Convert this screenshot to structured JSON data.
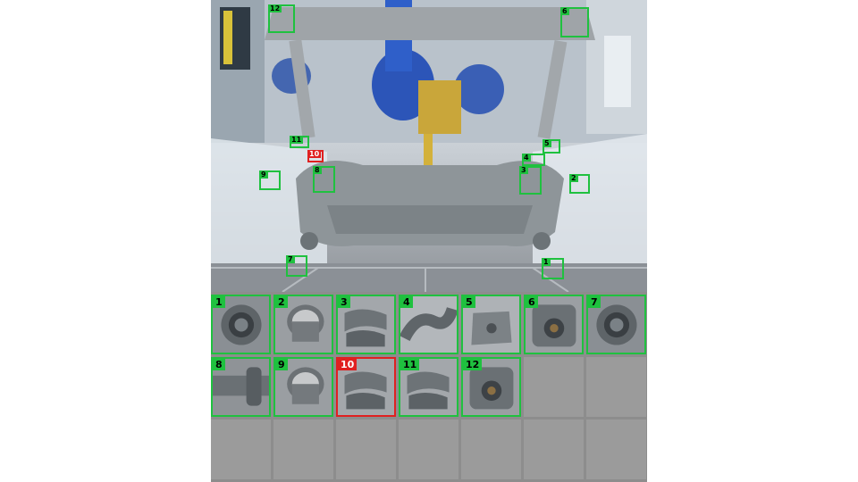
{
  "camera_view": {
    "detections": [
      {
        "label": "12",
        "status": "pass"
      },
      {
        "label": "6",
        "status": "pass"
      },
      {
        "label": "11",
        "status": "pass"
      },
      {
        "label": "5",
        "status": "pass"
      },
      {
        "label": "10",
        "status": "fail"
      },
      {
        "label": "4",
        "status": "pass"
      },
      {
        "label": "9",
        "status": "pass"
      },
      {
        "label": "8",
        "status": "pass"
      },
      {
        "label": "3",
        "status": "pass"
      },
      {
        "label": "2",
        "status": "pass"
      },
      {
        "label": "7",
        "status": "pass"
      },
      {
        "label": "1",
        "status": "pass"
      }
    ]
  },
  "thumbnails": [
    {
      "label": "1",
      "status": "pass",
      "icon": "round-bushing-icon"
    },
    {
      "label": "2",
      "status": "pass",
      "icon": "cylinder-bushing-icon"
    },
    {
      "label": "3",
      "status": "pass",
      "icon": "bracket-icon"
    },
    {
      "label": "4",
      "status": "pass",
      "icon": "bent-pipe-icon"
    },
    {
      "label": "5",
      "status": "pass",
      "icon": "mount-plate-icon"
    },
    {
      "label": "6",
      "status": "pass",
      "icon": "bushing-mount-icon"
    },
    {
      "label": "7",
      "status": "pass",
      "icon": "round-bushing-icon"
    },
    {
      "label": "8",
      "status": "pass",
      "icon": "tube-arm-icon"
    },
    {
      "label": "9",
      "status": "pass",
      "icon": "cylinder-bushing-icon"
    },
    {
      "label": "10",
      "status": "fail",
      "icon": "bracket-icon"
    },
    {
      "label": "11",
      "status": "pass",
      "icon": "bracket-icon"
    },
    {
      "label": "12",
      "status": "pass",
      "icon": "bushing-mount-icon"
    }
  ],
  "colors": {
    "pass": "#1fc13f",
    "fail": "#e02020",
    "empty_slot": "#9b9b9b"
  }
}
